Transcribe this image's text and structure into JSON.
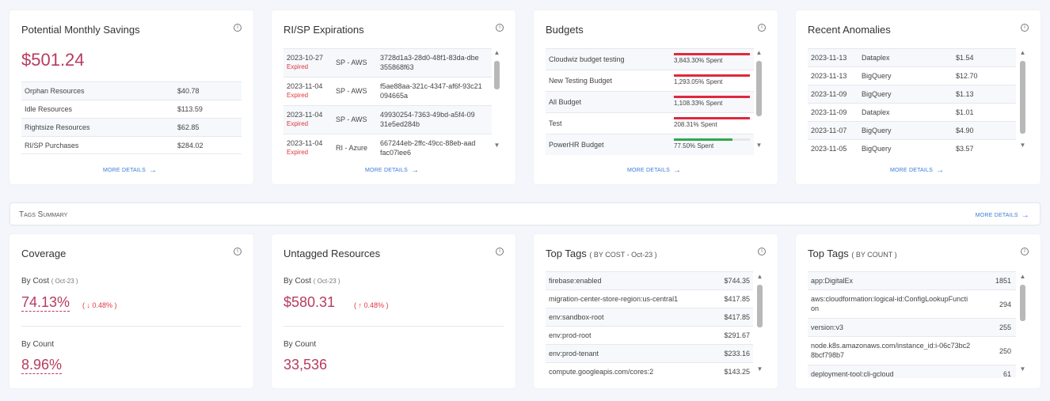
{
  "savings": {
    "title": "Potential Monthly Savings",
    "total": "$501.24",
    "rows": [
      {
        "label": "Orphan Resources",
        "value": "$40.78"
      },
      {
        "label": "Idle Resources",
        "value": "$113.59"
      },
      {
        "label": "Rightsize Resources",
        "value": "$62.85"
      },
      {
        "label": "RI/SP Purchases",
        "value": "$284.02"
      }
    ],
    "more": "MORE DETAILS"
  },
  "risp": {
    "title": "RI/SP Expirations",
    "rows": [
      {
        "date": "2023-10-27",
        "status": "Expired",
        "type": "SP - AWS",
        "id1": "3728d1a3-28d0-48f1-83da-dbe",
        "id2": "355868f63"
      },
      {
        "date": "2023-11-04",
        "status": "Expired",
        "type": "SP - AWS",
        "id1": "f5ae88aa-321c-4347-af6f-93c21",
        "id2": "094665a"
      },
      {
        "date": "2023-11-04",
        "status": "Expired",
        "type": "SP - AWS",
        "id1": "49930254-7363-49bd-a5f4-09",
        "id2": "31e5ed284b"
      },
      {
        "date": "2023-11-04",
        "status": "Expired",
        "type": "RI - Azure",
        "id1": "667244eb-2ffc-49cc-88eb-aad",
        "id2": "fac07lee6"
      }
    ],
    "more": "MORE DETAILS"
  },
  "budgets": {
    "title": "Budgets",
    "rows": [
      {
        "name": "Cloudwiz budget testing",
        "spent": "3,843.30% Spent",
        "fill": 1.0,
        "color": "#e0283e"
      },
      {
        "name": "New Testing Budget",
        "spent": "1,293.05% Spent",
        "fill": 1.0,
        "color": "#e0283e"
      },
      {
        "name": "All Budget",
        "spent": "1,108.33% Spent",
        "fill": 1.0,
        "color": "#e0283e"
      },
      {
        "name": "Test",
        "spent": "208.31% Spent",
        "fill": 1.0,
        "color": "#e0283e"
      },
      {
        "name": "PowerHR Budget",
        "spent": "77.50% Spent",
        "fill": 0.775,
        "color": "#2fa84f"
      }
    ],
    "more": "MORE DETAILS"
  },
  "anomalies": {
    "title": "Recent Anomalies",
    "rows": [
      {
        "date": "2023-11-13",
        "service": "Dataplex",
        "cost": "$1.54"
      },
      {
        "date": "2023-11-13",
        "service": "BigQuery",
        "cost": "$12.70"
      },
      {
        "date": "2023-11-09",
        "service": "BigQuery",
        "cost": "$1.13"
      },
      {
        "date": "2023-11-09",
        "service": "Dataplex",
        "cost": "$1.01"
      },
      {
        "date": "2023-11-07",
        "service": "BigQuery",
        "cost": "$4.90"
      },
      {
        "date": "2023-11-05",
        "service": "BigQuery",
        "cost": "$3.57"
      }
    ],
    "more": "MORE DETAILS"
  },
  "tags_summary": {
    "label": "Tags Summary",
    "more": "MORE DETAILS"
  },
  "coverage": {
    "title": "Coverage",
    "by_cost_label": "By Cost",
    "by_cost_period": "( Oct-23 )",
    "by_cost_value": "74.13%",
    "by_cost_delta": "( ↓ 0.48% )",
    "by_count_label": "By Count",
    "by_count_value": "8.96%"
  },
  "untagged": {
    "title": "Untagged Resources",
    "by_cost_label": "By Cost",
    "by_cost_period": "( Oct-23 )",
    "by_cost_value": "$580.31",
    "by_cost_delta": "( ↑ 0.48% )",
    "by_count_label": "By Count",
    "by_count_value": "33,536"
  },
  "top_tags_cost": {
    "title": "Top Tags",
    "subtitle": "( BY COST - Oct-23 )",
    "rows": [
      {
        "tag": "firebase:enabled",
        "value": "$744.35"
      },
      {
        "tag": "migration-center-store-region:us-central1",
        "value": "$417.85"
      },
      {
        "tag": "env:sandbox-root",
        "value": "$417.85"
      },
      {
        "tag": "env:prod-root",
        "value": "$291.67"
      },
      {
        "tag": "env:prod-tenant",
        "value": "$233.16"
      },
      {
        "tag": "compute.googleapis.com/cores:2",
        "value": "$143.25"
      }
    ]
  },
  "top_tags_count": {
    "title": "Top Tags",
    "subtitle": "( BY COUNT )",
    "rows": [
      {
        "tag": "app:DigitalEx",
        "tag2": "",
        "value": "1851"
      },
      {
        "tag": "aws:cloudformation:logical-id:ConfigLookupFuncti",
        "tag2": "on",
        "value": "294"
      },
      {
        "tag": "version:v3",
        "tag2": "",
        "value": "255"
      },
      {
        "tag": "node.k8s.amazonaws.com/instance_id:i-06c73bc2",
        "tag2": "8bcf798b7",
        "value": "250"
      },
      {
        "tag": "deployment-tool:cli-gcloud",
        "tag2": "",
        "value": "61"
      }
    ]
  }
}
